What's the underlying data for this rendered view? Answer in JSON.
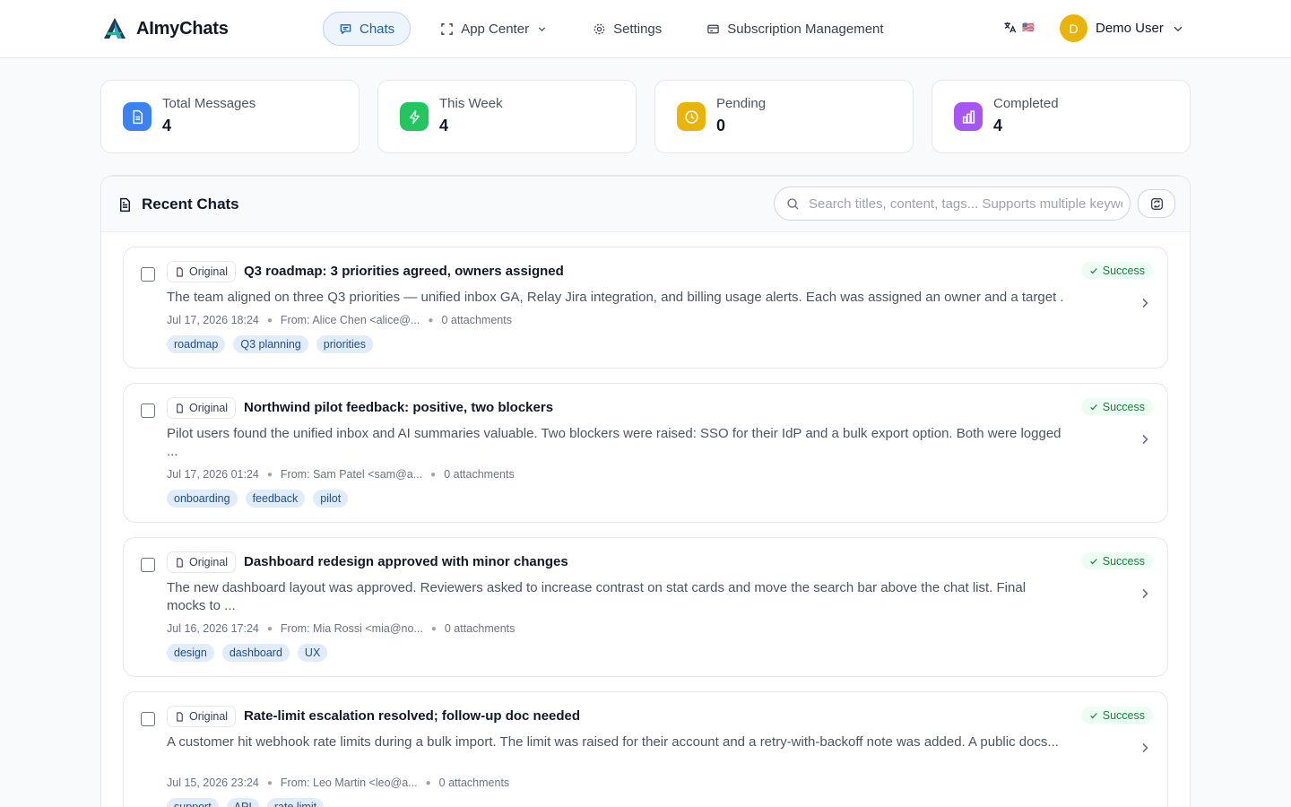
{
  "app": {
    "name": "AImyChats"
  },
  "nav": {
    "chats": "Chats",
    "app_center": "App Center",
    "settings": "Settings",
    "subscription": "Subscription Management"
  },
  "language": {
    "icon": "translate-icon",
    "flag": "🇺🇸"
  },
  "user": {
    "initial": "D",
    "name": "Demo User"
  },
  "stats": [
    {
      "label": "Total Messages",
      "value": "4",
      "icon": "document-icon",
      "color": "#3b82f6"
    },
    {
      "label": "This Week",
      "value": "4",
      "icon": "lightning-icon",
      "color": "#22c55e"
    },
    {
      "label": "Pending",
      "value": "0",
      "icon": "clock-icon",
      "color": "#eab308"
    },
    {
      "label": "Completed",
      "value": "4",
      "icon": "bar-chart-icon",
      "color": "#a855f7"
    }
  ],
  "recent": {
    "title": "Recent Chats",
    "search_placeholder": "Search titles, content, tags... Supports multiple keywords"
  },
  "chats": [
    {
      "badge": "Original",
      "title": "Q3 roadmap: 3 priorities agreed, owners assigned",
      "summary": "The team aligned on three Q3 priorities — unified inbox GA, Relay Jira integration, and billing usage alerts. Each was assigned an owner and a target ...",
      "date": "Jul 17, 2026 18:24",
      "from": "From: Alice Chen <alice@...",
      "attachments": "0 attachments",
      "tags": [
        "roadmap",
        "Q3 planning",
        "priorities"
      ],
      "status": "Success"
    },
    {
      "badge": "Original",
      "title": "Northwind pilot feedback: positive, two blockers",
      "summary": "Pilot users found the unified inbox and AI summaries valuable. Two blockers were raised: SSO for their IdP and a bulk export option. Both were logged ...",
      "date": "Jul 17, 2026 01:24",
      "from": "From: Sam Patel <sam@a...",
      "attachments": "0 attachments",
      "tags": [
        "onboarding",
        "feedback",
        "pilot"
      ],
      "status": "Success"
    },
    {
      "badge": "Original",
      "title": "Dashboard redesign approved with minor changes",
      "summary": "The new dashboard layout was approved. Reviewers asked to increase contrast on stat cards and move the search bar above the chat list. Final mocks to ...",
      "date": "Jul 16, 2026 17:24",
      "from": "From: Mia Rossi <mia@no...",
      "attachments": "0 attachments",
      "tags": [
        "design",
        "dashboard",
        "UX"
      ],
      "status": "Success"
    },
    {
      "badge": "Original",
      "title": "Rate-limit escalation resolved; follow-up doc needed",
      "summary": "A customer hit webhook rate limits during a bulk import. The limit was raised for their account and a retry-with-backoff note was added. A public docs...",
      "date": "Jul 15, 2026 23:24",
      "from": "From: Leo Martin <leo@a...",
      "attachments": "0 attachments",
      "tags": [
        "support",
        "API",
        "rate limit"
      ],
      "status": "Success"
    }
  ]
}
